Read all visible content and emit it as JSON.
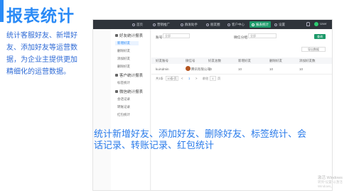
{
  "heading": "报表统计",
  "description": "统计客服好友、新增好友、添加好友等运营数据，为企业主提供更加精细化的运营数据。",
  "screenshot": {
    "nav": [
      {
        "label": "首页"
      },
      {
        "label": "营销推广"
      },
      {
        "label": "群发助手"
      },
      {
        "label": "朋友圈"
      },
      {
        "label": "客户中心"
      },
      {
        "label": "报表统计",
        "active": true
      },
      {
        "label": "设置"
      }
    ],
    "user": "User",
    "sidebar": {
      "groups": [
        {
          "label": "好友统计报表",
          "items": [
            "新增好友",
            "删除好友",
            "添加好友",
            "删除好友"
          ]
        },
        {
          "label": "客户统计报表",
          "items": [
            "标签统计"
          ]
        },
        {
          "label": "微信统计报表",
          "items": [
            "会话记录",
            "转账记录",
            "红包统计"
          ]
        }
      ]
    },
    "filters": {
      "account_label": "账号",
      "account_value": "全部",
      "group_label": "微信分组",
      "group_value": "全部",
      "query_button": "查询",
      "export_button": "导出数据"
    },
    "table": {
      "headers": [
        "好友账号",
        "微信号",
        "好友总数",
        "新增好友",
        "删除好友",
        "添加好友数"
      ],
      "rows": [
        [
          "kuiAdmin",
          "腾讯有限公司",
          "10",
          "10",
          "10",
          "10"
        ]
      ]
    },
    "pager": {
      "total": "共1条",
      "per_page": "10条/页",
      "prev": "<",
      "page": "1",
      "next": ">",
      "goto": "前往",
      "goto_value": "1",
      "page_suffix": "页"
    }
  },
  "caption": "统计新增好友、添加好友、删除好友、标签统计、会话记录、转账记录、红包统计",
  "watermark": {
    "line1": "激活 Windows",
    "line2": "转到\"设置\"以激活 Windows。"
  }
}
